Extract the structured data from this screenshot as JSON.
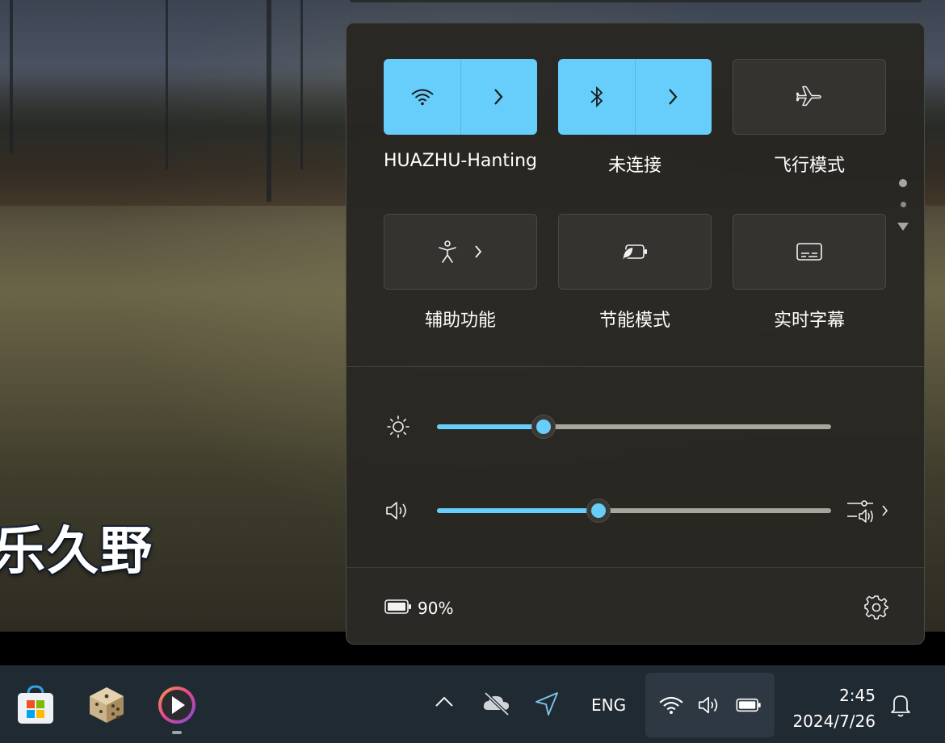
{
  "wallpaper": {
    "subtitle_text": "乐久野"
  },
  "quick_settings": {
    "tiles": [
      {
        "label": "HUAZHU-Hanting",
        "icon": "wifi-icon",
        "state": "on",
        "has_chevron": true
      },
      {
        "label": "未连接",
        "icon": "bluetooth-icon",
        "state": "on",
        "has_chevron": true
      },
      {
        "label": "飞行模式",
        "icon": "airplane-icon",
        "state": "off",
        "has_chevron": false
      },
      {
        "label": "辅助功能",
        "icon": "accessibility-icon",
        "state": "off",
        "has_chevron": true
      },
      {
        "label": "节能模式",
        "icon": "energy-saver-icon",
        "state": "off",
        "has_chevron": false
      },
      {
        "label": "实时字幕",
        "icon": "live-captions-icon",
        "state": "off",
        "has_chevron": false
      }
    ],
    "brightness": {
      "icon": "brightness-icon",
      "level_percent": 27
    },
    "volume": {
      "icon": "speaker-icon",
      "level_percent": 41,
      "mixer_icon": "sound-mixer-icon"
    },
    "battery": {
      "icon": "battery-icon",
      "text": "90%"
    },
    "settings_icon": "gear-icon",
    "accent_color": "#67cdfb"
  },
  "taskbar": {
    "apps": [
      {
        "name": "Microsoft Store",
        "icon": "store-icon"
      },
      {
        "name": "Dice app",
        "icon": "dice-icon"
      },
      {
        "name": "Media player",
        "icon": "media-player-icon",
        "running": true
      }
    ],
    "tray": {
      "overflow_icon": "chevron-up-icon",
      "onedrive_icon": "onedrive-offline-icon",
      "location_icon": "location-icon",
      "language": "ENG",
      "status_icons": [
        "wifi-icon",
        "speaker-icon",
        "battery-icon"
      ]
    },
    "clock": {
      "time": "2:45",
      "date": "2024/7/26"
    },
    "notification_icon": "bell-icon"
  }
}
